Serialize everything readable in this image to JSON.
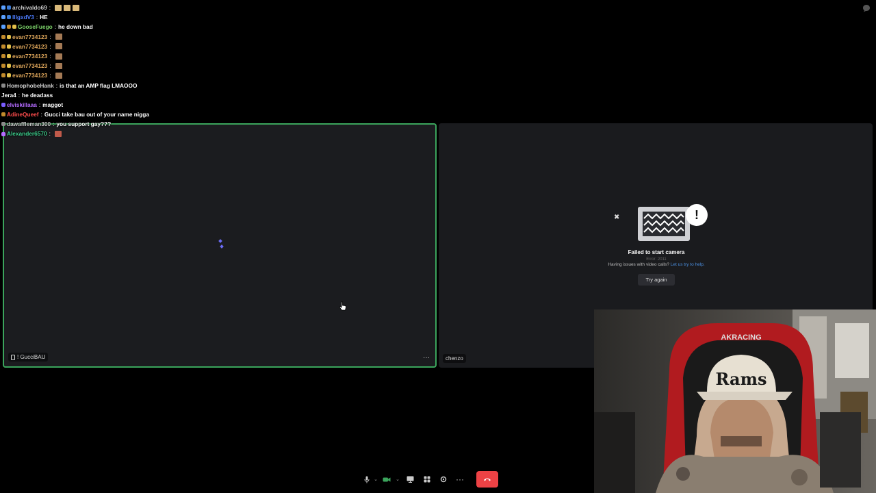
{
  "chat": [
    {
      "user": "archivaldo69",
      "color": "#c8c8c8",
      "message": "",
      "badges": [
        "#5aa0ff",
        "#3a7bd5"
      ],
      "emotes": [
        "#d9b97a",
        "#d9b97a",
        "#d9b97a"
      ]
    },
    {
      "user": "lllgxdV3",
      "color": "#4d7dff",
      "message": "HE",
      "badges": [
        "#5aa0ff",
        "#3a7bd5"
      ],
      "emotes": []
    },
    {
      "user": "GooseFuego",
      "color": "#7dd36a",
      "message": "he down bad",
      "badges": [
        "#5aa0ff",
        "#c28b2c",
        "#e2c04a"
      ],
      "emotes": []
    },
    {
      "user": "evan7734123",
      "color": "#e2a95c",
      "message": "",
      "badges": [
        "#c28b2c",
        "#e2c04a"
      ],
      "emotes": [
        "#a47a55"
      ]
    },
    {
      "user": "evan7734123",
      "color": "#e2a95c",
      "message": "",
      "badges": [
        "#c28b2c",
        "#e2c04a"
      ],
      "emotes": [
        "#a47a55"
      ]
    },
    {
      "user": "evan7734123",
      "color": "#e2a95c",
      "message": "",
      "badges": [
        "#c28b2c",
        "#e2c04a"
      ],
      "emotes": [
        "#a47a55"
      ]
    },
    {
      "user": "evan7734123",
      "color": "#e2a95c",
      "message": "",
      "badges": [
        "#c28b2c",
        "#e2c04a"
      ],
      "emotes": [
        "#a47a55"
      ]
    },
    {
      "user": "evan7734123",
      "color": "#e2a95c",
      "message": "",
      "badges": [
        "#c28b2c",
        "#e2c04a"
      ],
      "emotes": [
        "#a47a55"
      ]
    },
    {
      "user": "HomophobeHank",
      "color": "#d0d0d0",
      "message": "is that an AMP flag LMAOOO",
      "badges": [
        "#8a8a8a"
      ],
      "emotes": []
    },
    {
      "user": "Jera4",
      "color": "#ffffff",
      "message": "he deadass",
      "badges": [],
      "emotes": []
    },
    {
      "user": "elviskillaaa",
      "color": "#b46bff",
      "message": "maggot",
      "badges": [
        "#7a5cff"
      ],
      "emotes": []
    },
    {
      "user": "AdineQueef",
      "color": "#ff4d4d",
      "message": "Gucci take bau out of your name nigga",
      "badges": [
        "#c28b2c"
      ],
      "emotes": []
    },
    {
      "user": "dawaffleman300",
      "color": "#c8c8c8",
      "message": "you support gay???",
      "badges": [
        "#8a8a8a"
      ],
      "emotes": []
    },
    {
      "user": "Alexander6570",
      "color": "#3ecf8e",
      "message": "",
      "badges": [
        "#b46bff"
      ],
      "emotes": [
        "#c05a4a"
      ]
    }
  ],
  "tiles": {
    "left": {
      "name": "! GucciBAU"
    },
    "right": {
      "name": "chenzo"
    }
  },
  "camera_error": {
    "title": "Failed to start camera",
    "code": "Error: 2011",
    "help_prefix": "Having issues with video calls?",
    "help_link": "Let us try to help.",
    "button": "Try again"
  },
  "webcam": {
    "cap_text": "Rams",
    "chair_brand": "AKRACING"
  },
  "colors": {
    "speaking_border": "#3ba55c",
    "end_call": "#ed4245",
    "camera_on": "#3ba55c"
  }
}
